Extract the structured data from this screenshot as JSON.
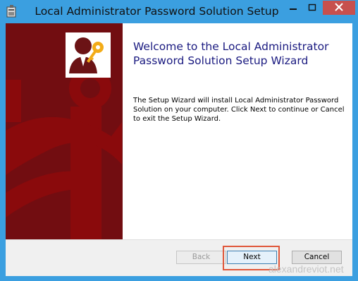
{
  "window": {
    "title": "Local Administrator Password Solution Setup",
    "controls": {
      "minimize": "─",
      "maximize": "□",
      "close": "✕"
    }
  },
  "content": {
    "heading": "Welcome to the Local Administrator Password Solution Setup Wizard",
    "description": "The Setup Wizard will install Local Administrator Password Solution on your computer. Click Next to continue or Cancel to exit the Setup Wizard."
  },
  "buttons": {
    "back": {
      "label": "Back",
      "enabled": false
    },
    "next": {
      "label": "Next",
      "enabled": true
    },
    "cancel": {
      "label": "Cancel",
      "enabled": true
    }
  },
  "watermark": "alexandreviot.net",
  "colors": {
    "title_bar": "#3b9fe0",
    "banner": "#720d11",
    "banner_anchor": "#8a0a0c",
    "heading_text": "#1a1a80",
    "close_button": "#c7504e",
    "highlight": "#e0573a"
  },
  "icons": {
    "app": "installer-icon",
    "logo": "admin-user-key-icon",
    "banner_art": "anchor-graphic"
  }
}
